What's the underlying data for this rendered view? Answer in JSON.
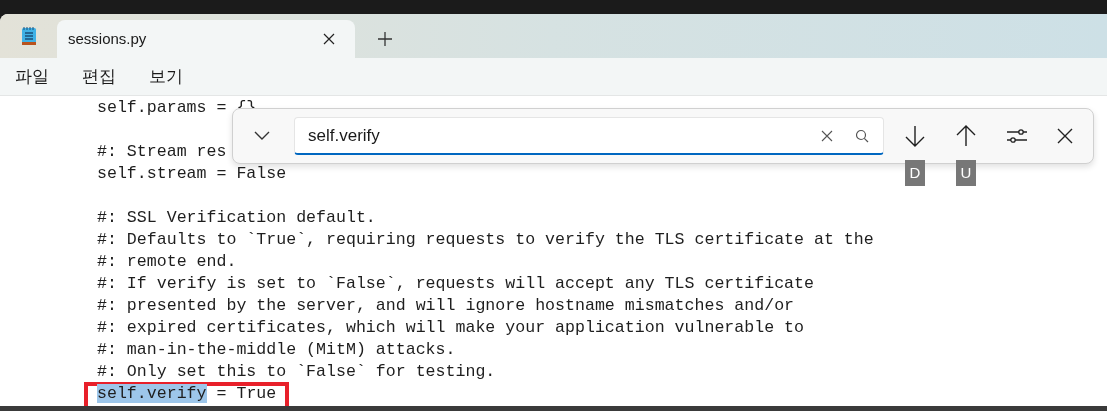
{
  "tabs": [
    {
      "label": "sessions.py",
      "selected": true
    }
  ],
  "menu": [
    "파일",
    "편집",
    "보기"
  ],
  "find": {
    "value": "self.verify",
    "shortcuts": [
      {
        "kind": "next",
        "key": "D"
      },
      {
        "kind": "previous",
        "key": "U"
      }
    ]
  },
  "blocks": [
    [
      {
        "text": "self.params = {}"
      }
    ],
    [
      {
        "text": "#: Stream res"
      },
      {
        "text": "self.stream = False"
      }
    ],
    [
      {
        "text": "#: SSL Verification default."
      },
      {
        "text": "#: Defaults to `True`, requiring requests to verify the TLS certificate at the"
      },
      {
        "text": "#: remote end."
      },
      {
        "text": "#: If verify is set to `False`, requests will accept any TLS certificate"
      },
      {
        "text": "#: presented by the server, and will ignore hostname mismatches and/or"
      },
      {
        "text": "#: expired certificates, which will make your application vulnerable to"
      },
      {
        "text": "#: man-in-the-middle (MitM) attacks."
      },
      {
        "text": "#: Only set this to `False` for testing."
      },
      {
        "kind": "match",
        "match": "self.verify",
        "rest": " = True",
        "boxed": true
      }
    ]
  ]
}
